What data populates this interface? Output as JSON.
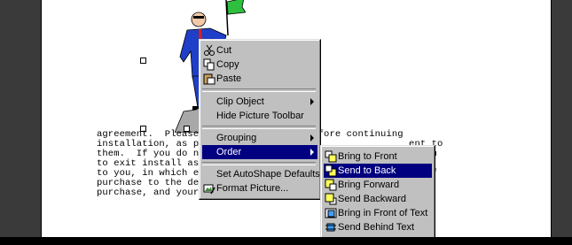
{
  "document": {
    "lines": [
      "agreement.  Please r                 before continuing",
      "installation, as pre                                   ent to",
      "them.  If you do not                                  button",
      "to exit install as P                                 ftware",
      "to you, in which eve                                 roof of",
      "purchase to the deal                                 ys of",
      "purchase, and your m"
    ]
  },
  "context_menu": {
    "items": [
      {
        "label": "Cut",
        "icon": "scissors-icon"
      },
      {
        "label": "Copy",
        "icon": "copy-icon"
      },
      {
        "label": "Paste",
        "icon": "paste-icon"
      },
      {
        "label": "Clip Object"
      },
      {
        "label": "Hide Picture Toolbar"
      },
      {
        "label": "Grouping"
      },
      {
        "label": "Order"
      },
      {
        "label": "Set AutoShape Defaults"
      },
      {
        "label": "Format Picture...",
        "icon": "format-picture-icon"
      }
    ]
  },
  "order_submenu": {
    "items": [
      {
        "label": "Bring to Front",
        "icon": "bring-to-front-icon"
      },
      {
        "label": "Send to Back",
        "icon": "send-to-back-icon"
      },
      {
        "label": "Bring Forward",
        "icon": "bring-forward-icon"
      },
      {
        "label": "Send Backward",
        "icon": "send-backward-icon"
      },
      {
        "label": "Bring in Front of Text",
        "icon": "bring-in-front-of-text-icon"
      },
      {
        "label": "Send Behind Text",
        "icon": "send-behind-text-icon"
      }
    ]
  },
  "colors": {
    "menu_face": "#c0c0c0",
    "selection": "#000080",
    "page": "#ffffff"
  }
}
